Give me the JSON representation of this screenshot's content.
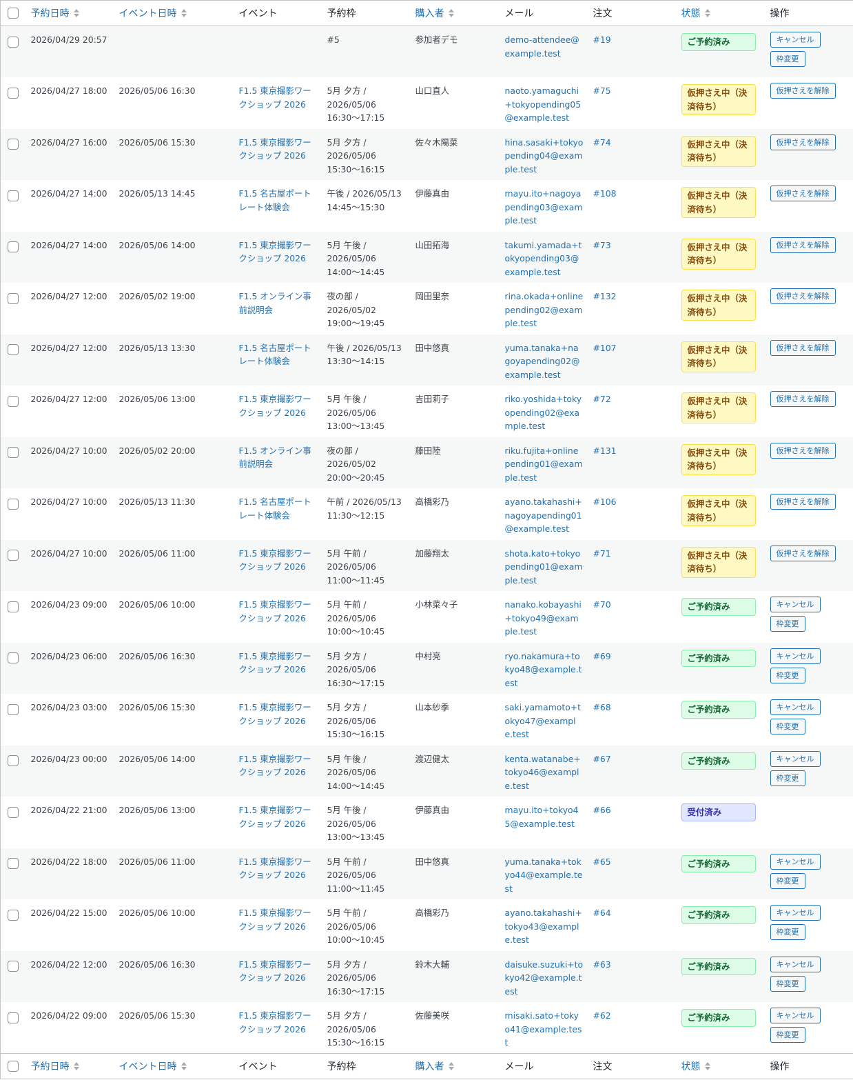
{
  "columns": [
    "予約日時",
    "イベント日時",
    "イベント",
    "予約枠",
    "購入者",
    "メール",
    "注文",
    "状態",
    "操作"
  ],
  "labels": {
    "cancel": "キャンセル",
    "change": "枠変更",
    "release": "仮押さえを解除"
  },
  "rows": [
    {
      "booked": "2026/04/29 20:57",
      "event_date": "",
      "event": "",
      "slot": "#5",
      "buyer": "参加者デモ",
      "email": "demo-attendee@example.test",
      "order": "#19",
      "status": "ご予約済み",
      "status_type": "ok"
    },
    {
      "booked": "2026/04/27 18:00",
      "event_date": "2026/05/06 16:30",
      "event": "F1.5 東京撮影ワークショップ 2026",
      "slot": "5月 夕方 / 2026/05/06 16:30〜17:15",
      "buyer": "山口直人",
      "email": "naoto.yamaguchi+tokyopending05@example.test",
      "order": "#75",
      "status": "仮押さえ中（決済待ち）",
      "status_type": "pend"
    },
    {
      "booked": "2026/04/27 16:00",
      "event_date": "2026/05/06 15:30",
      "event": "F1.5 東京撮影ワークショップ 2026",
      "slot": "5月 夕方 / 2026/05/06 15:30〜16:15",
      "buyer": "佐々木陽菜",
      "email": "hina.sasaki+tokyopending04@example.test",
      "order": "#74",
      "status": "仮押さえ中（決済待ち）",
      "status_type": "pend"
    },
    {
      "booked": "2026/04/27 14:00",
      "event_date": "2026/05/13 14:45",
      "event": "F1.5 名古屋ポートレート体験会",
      "slot": "午後 / 2026/05/13 14:45〜15:30",
      "buyer": "伊藤真由",
      "email": "mayu.ito+nagoyapending03@example.test",
      "order": "#108",
      "status": "仮押さえ中（決済待ち）",
      "status_type": "pend"
    },
    {
      "booked": "2026/04/27 14:00",
      "event_date": "2026/05/06 14:00",
      "event": "F1.5 東京撮影ワークショップ 2026",
      "slot": "5月 午後 / 2026/05/06 14:00〜14:45",
      "buyer": "山田拓海",
      "email": "takumi.yamada+tokyopending03@example.test",
      "order": "#73",
      "status": "仮押さえ中（決済待ち）",
      "status_type": "pend"
    },
    {
      "booked": "2026/04/27 12:00",
      "event_date": "2026/05/02 19:00",
      "event": "F1.5 オンライン事前説明会",
      "slot": "夜の部 / 2026/05/02 19:00〜19:45",
      "buyer": "岡田里奈",
      "email": "rina.okada+onlinepending02@example.test",
      "order": "#132",
      "status": "仮押さえ中（決済待ち）",
      "status_type": "pend"
    },
    {
      "booked": "2026/04/27 12:00",
      "event_date": "2026/05/13 13:30",
      "event": "F1.5 名古屋ポートレート体験会",
      "slot": "午後 / 2026/05/13 13:30〜14:15",
      "buyer": "田中悠真",
      "email": "yuma.tanaka+nagoyapending02@example.test",
      "order": "#107",
      "status": "仮押さえ中（決済待ち）",
      "status_type": "pend"
    },
    {
      "booked": "2026/04/27 12:00",
      "event_date": "2026/05/06 13:00",
      "event": "F1.5 東京撮影ワークショップ 2026",
      "slot": "5月 午後 / 2026/05/06 13:00〜13:45",
      "buyer": "吉田莉子",
      "email": "riko.yoshida+tokyopending02@example.test",
      "order": "#72",
      "status": "仮押さえ中（決済待ち）",
      "status_type": "pend"
    },
    {
      "booked": "2026/04/27 10:00",
      "event_date": "2026/05/02 20:00",
      "event": "F1.5 オンライン事前説明会",
      "slot": "夜の部 / 2026/05/02 20:00〜20:45",
      "buyer": "藤田陸",
      "email": "riku.fujita+onlinepending01@example.test",
      "order": "#131",
      "status": "仮押さえ中（決済待ち）",
      "status_type": "pend"
    },
    {
      "booked": "2026/04/27 10:00",
      "event_date": "2026/05/13 11:30",
      "event": "F1.5 名古屋ポートレート体験会",
      "slot": "午前 / 2026/05/13 11:30〜12:15",
      "buyer": "高橋彩乃",
      "email": "ayano.takahashi+nagoyapending01@example.test",
      "order": "#106",
      "status": "仮押さえ中（決済待ち）",
      "status_type": "pend"
    },
    {
      "booked": "2026/04/27 10:00",
      "event_date": "2026/05/06 11:00",
      "event": "F1.5 東京撮影ワークショップ 2026",
      "slot": "5月 午前 / 2026/05/06 11:00〜11:45",
      "buyer": "加藤翔太",
      "email": "shota.kato+tokyopending01@example.test",
      "order": "#71",
      "status": "仮押さえ中（決済待ち）",
      "status_type": "pend"
    },
    {
      "booked": "2026/04/23 09:00",
      "event_date": "2026/05/06 10:00",
      "event": "F1.5 東京撮影ワークショップ 2026",
      "slot": "5月 午前 / 2026/05/06 10:00〜10:45",
      "buyer": "小林菜々子",
      "email": "nanako.kobayashi+tokyo49@example.test",
      "order": "#70",
      "status": "ご予約済み",
      "status_type": "ok"
    },
    {
      "booked": "2026/04/23 06:00",
      "event_date": "2026/05/06 16:30",
      "event": "F1.5 東京撮影ワークショップ 2026",
      "slot": "5月 夕方 / 2026/05/06 16:30〜17:15",
      "buyer": "中村亮",
      "email": "ryo.nakamura+tokyo48@example.test",
      "order": "#69",
      "status": "ご予約済み",
      "status_type": "ok"
    },
    {
      "booked": "2026/04/23 03:00",
      "event_date": "2026/05/06 15:30",
      "event": "F1.5 東京撮影ワークショップ 2026",
      "slot": "5月 夕方 / 2026/05/06 15:30〜16:15",
      "buyer": "山本紗季",
      "email": "saki.yamamoto+tokyo47@example.test",
      "order": "#68",
      "status": "ご予約済み",
      "status_type": "ok"
    },
    {
      "booked": "2026/04/23 00:00",
      "event_date": "2026/05/06 14:00",
      "event": "F1.5 東京撮影ワークショップ 2026",
      "slot": "5月 午後 / 2026/05/06 14:00〜14:45",
      "buyer": "渡辺健太",
      "email": "kenta.watanabe+tokyo46@example.test",
      "order": "#67",
      "status": "ご予約済み",
      "status_type": "ok"
    },
    {
      "booked": "2026/04/22 21:00",
      "event_date": "2026/05/06 13:00",
      "event": "F1.5 東京撮影ワークショップ 2026",
      "slot": "5月 午後 / 2026/05/06 13:00〜13:45",
      "buyer": "伊藤真由",
      "email": "mayu.ito+tokyo45@example.test",
      "order": "#66",
      "status": "受付済み",
      "status_type": "recv"
    },
    {
      "booked": "2026/04/22 18:00",
      "event_date": "2026/05/06 11:00",
      "event": "F1.5 東京撮影ワークショップ 2026",
      "slot": "5月 午前 / 2026/05/06 11:00〜11:45",
      "buyer": "田中悠真",
      "email": "yuma.tanaka+tokyo44@example.test",
      "order": "#65",
      "status": "ご予約済み",
      "status_type": "ok"
    },
    {
      "booked": "2026/04/22 15:00",
      "event_date": "2026/05/06 10:00",
      "event": "F1.5 東京撮影ワークショップ 2026",
      "slot": "5月 午前 / 2026/05/06 10:00〜10:45",
      "buyer": "高橋彩乃",
      "email": "ayano.takahashi+tokyo43@example.test",
      "order": "#64",
      "status": "ご予約済み",
      "status_type": "ok"
    },
    {
      "booked": "2026/04/22 12:00",
      "event_date": "2026/05/06 16:30",
      "event": "F1.5 東京撮影ワークショップ 2026",
      "slot": "5月 夕方 / 2026/05/06 16:30〜17:15",
      "buyer": "鈴木大輔",
      "email": "daisuke.suzuki+tokyo42@example.test",
      "order": "#63",
      "status": "ご予約済み",
      "status_type": "ok"
    },
    {
      "booked": "2026/04/22 09:00",
      "event_date": "2026/05/06 15:30",
      "event": "F1.5 東京撮影ワークショップ 2026",
      "slot": "5月 夕方 / 2026/05/06 15:30〜16:15",
      "buyer": "佐藤美咲",
      "email": "misaki.sato+tokyo41@example.test",
      "order": "#62",
      "status": "ご予約済み",
      "status_type": "ok"
    }
  ]
}
